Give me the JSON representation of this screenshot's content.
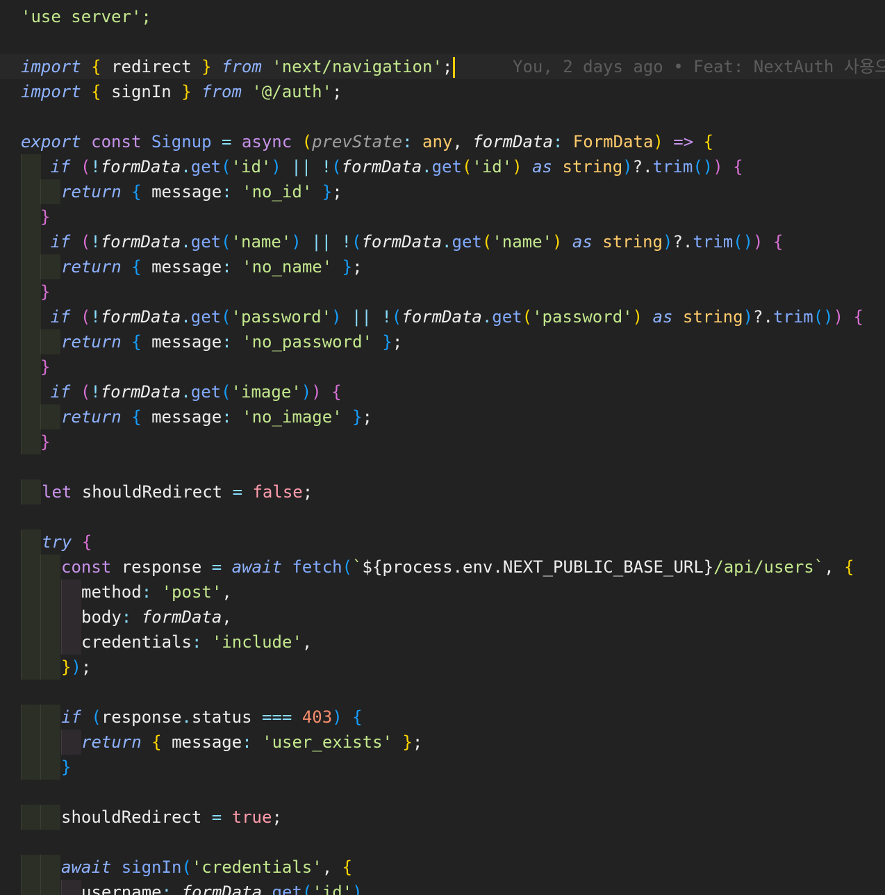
{
  "editor": {
    "blame": "You, 2 days ago • Feat: NextAuth 사용으",
    "lines": {
      "l1": "'use server';",
      "l3a": "import",
      "l3b": "redirect",
      "l3c": "from",
      "l3d": "'next/navigation'",
      "l4a": "import",
      "l4b": "signIn",
      "l4c": "from",
      "l4d": "'@/auth'",
      "l6a": "export",
      "l6b": "const",
      "l6c": "Signup",
      "l6d": "async",
      "l6e": "prevState",
      "l6f": "any",
      "l6g": "formData",
      "l6h": "FormData",
      "id_str": "'id'",
      "name_str": "'name'",
      "password_str": "'password'",
      "image_str": "'image'",
      "no_id": "'no_id'",
      "no_name": "'no_name'",
      "no_password": "'no_password'",
      "no_image": "'no_image'",
      "let_line": "shouldRedirect",
      "false_val": "false",
      "fetch_url_a": "process.env.NEXT_PUBLIC_BASE_URL",
      "fetch_url_b": "/api/users",
      "method_val": "'post'",
      "credentials_val": "'include'",
      "status_num": "403",
      "user_exists": "'user_exists'",
      "true_val": "true",
      "credentials_provider": "'credentials'",
      "username_key": "username",
      "username_arg": "'id'"
    }
  }
}
